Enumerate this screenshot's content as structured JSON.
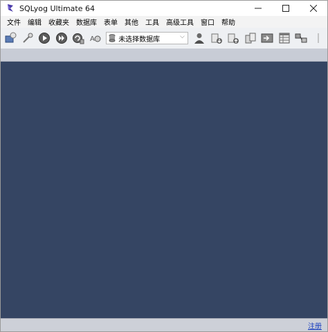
{
  "window": {
    "title": "SQLyog Ultimate 64",
    "controls": {
      "minimize": "—",
      "maximize": "☐",
      "close": "✕"
    }
  },
  "menubar": {
    "items": [
      "文件",
      "编辑",
      "收藏夹",
      "数据库",
      "表单",
      "其他",
      "工具",
      "高级工具",
      "窗口",
      "帮助"
    ]
  },
  "toolbar": {
    "database_selector": {
      "value": "未选择数据库"
    }
  },
  "statusbar": {
    "register_link": "注册"
  },
  "colors": {
    "workspace": "#354563",
    "subband": "#c8ccd6",
    "status_link": "#1a3fbf"
  }
}
